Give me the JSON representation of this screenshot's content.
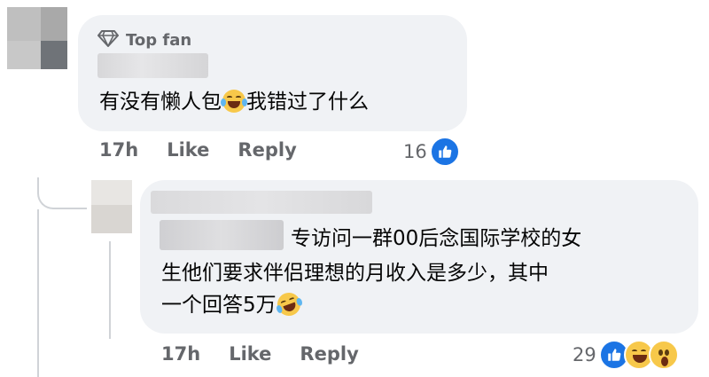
{
  "comment1": {
    "badge": "Top fan",
    "badge_icon": "diamond-icon",
    "text_before_emoji": "有没有懒人包",
    "emoji": "crying-laughing-emoji",
    "text_after_emoji": "我错过了什么",
    "time": "17h",
    "like_label": "Like",
    "reply_label": "Reply",
    "reaction_count": "16",
    "reactions": [
      "like-icon"
    ]
  },
  "comment2": {
    "line1": "专访问一群00后念国际学校的女",
    "line2": "生他们要求伴侣理想的月收入是多少，其中",
    "line3": "一个回答5万",
    "emoji": "rolling-laughing-emoji",
    "time": "17h",
    "like_label": "Like",
    "reply_label": "Reply",
    "reaction_count": "29",
    "reactions": [
      "like-icon",
      "haha-icon",
      "wow-icon"
    ]
  },
  "colors": {
    "bubble": "#f0f2f5",
    "meta_text": "#65676b",
    "like_blue": "#1b74e4",
    "emoji_yellow": "#f7c84a"
  }
}
